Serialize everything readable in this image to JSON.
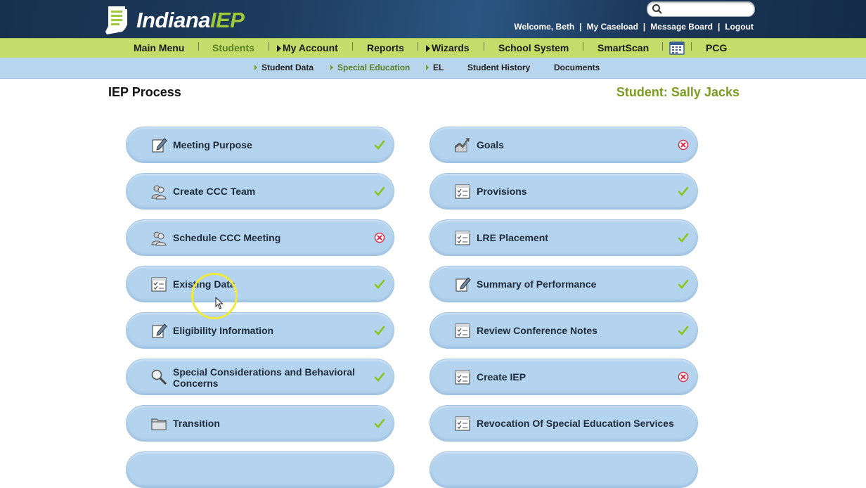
{
  "header": {
    "logo_text_white": "Indiana",
    "logo_text_green": "IEP",
    "search": {
      "value": "",
      "placeholder": ""
    },
    "links": [
      "Welcome, Beth",
      "My Caseload",
      "Message Board",
      "Logout"
    ],
    "separator": "|"
  },
  "mainnav": {
    "items": [
      {
        "label": "Main Menu"
      },
      {
        "label": "Students"
      },
      {
        "label": "My Account"
      },
      {
        "label": "Reports"
      },
      {
        "label": "Wizards"
      },
      {
        "label": "School System"
      },
      {
        "label": "SmartScan"
      },
      {
        "label": "PCG"
      }
    ],
    "active": "Students"
  },
  "subnav": {
    "items": [
      {
        "label": "Student Data"
      },
      {
        "label": "Special Education"
      },
      {
        "label": "EL"
      },
      {
        "label": "Student History"
      },
      {
        "label": "Documents"
      }
    ],
    "active": "Special Education"
  },
  "page": {
    "title": "IEP Process",
    "student": "Student: Sally Jacks"
  },
  "colors": {
    "brand_green": "#9ec93b",
    "nav_green": "#c3dc6a",
    "subnav_blue": "#b8d5ee",
    "button_blue": "#b3d3ee",
    "check_green": "#8cc41a",
    "error_red": "#d9304a"
  },
  "process": {
    "left": [
      {
        "label": "Meeting Purpose",
        "icon": "edit-icon",
        "status": "complete"
      },
      {
        "label": "Create CCC Team",
        "icon": "people-icon",
        "status": "complete"
      },
      {
        "label": "Schedule CCC Meeting",
        "icon": "people-icon",
        "status": "incomplete"
      },
      {
        "label": "Existing Data",
        "icon": "checklist-icon",
        "status": "complete"
      },
      {
        "label": "Eligibility Information",
        "icon": "edit-icon",
        "status": "complete"
      },
      {
        "label": "Special Considerations and Behavioral Concerns",
        "icon": "magnifier-icon",
        "status": "complete"
      },
      {
        "label": "Transition",
        "icon": "folder-icon",
        "status": "complete"
      }
    ],
    "right": [
      {
        "label": "Goals",
        "icon": "chart-icon",
        "status": "incomplete"
      },
      {
        "label": "Provisions",
        "icon": "checklist-icon",
        "status": "complete"
      },
      {
        "label": "LRE Placement",
        "icon": "checklist-icon",
        "status": "complete"
      },
      {
        "label": "Summary of Performance",
        "icon": "edit-icon",
        "status": "complete"
      },
      {
        "label": "Review Conference Notes",
        "icon": "checklist-icon",
        "status": "complete"
      },
      {
        "label": "Create IEP",
        "icon": "checklist-icon",
        "status": "incomplete"
      },
      {
        "label": "Revocation Of Special Education Services",
        "icon": "checklist-icon",
        "status": "none"
      }
    ]
  }
}
